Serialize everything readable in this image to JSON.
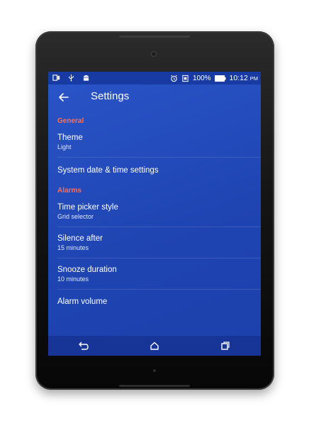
{
  "status_bar": {
    "battery": "100%",
    "time": "10:12",
    "ampm": "PM",
    "icons_left": [
      "screen-icon",
      "usb-icon",
      "android-icon"
    ],
    "icons_right": [
      "alarm-icon",
      "sim-icon",
      "battery-icon"
    ]
  },
  "toolbar": {
    "title": "Settings"
  },
  "sections": [
    {
      "header": "General",
      "items": [
        {
          "title": "Theme",
          "summary": "Light"
        },
        {
          "title": "System date & time settings",
          "summary": ""
        }
      ]
    },
    {
      "header": "Alarms",
      "items": [
        {
          "title": "Time picker style",
          "summary": "Grid selector"
        },
        {
          "title": "Silence after",
          "summary": "15 minutes"
        },
        {
          "title": "Snooze duration",
          "summary": "10 minutes"
        },
        {
          "title": "Alarm volume",
          "summary": ""
        }
      ]
    }
  ],
  "colors": {
    "screen_bg": "#2350c0",
    "section_header": "#ff6e57",
    "status_bar": "#173aa3",
    "nav_bar": "#163597"
  }
}
